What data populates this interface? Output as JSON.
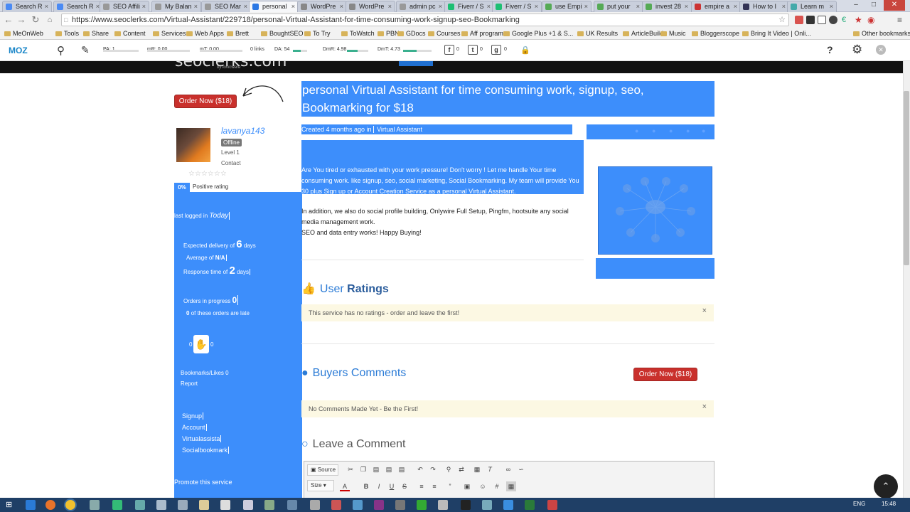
{
  "browser": {
    "tabs": [
      {
        "label": "Search R",
        "color": "#4a8af4",
        "active": false
      },
      {
        "label": "Search R",
        "color": "#4a8af4",
        "active": false
      },
      {
        "label": "SEO Affili",
        "color": "#999",
        "active": false
      },
      {
        "label": "My Balan",
        "color": "#999",
        "active": false
      },
      {
        "label": "SEO Mar",
        "color": "#999",
        "active": false
      },
      {
        "label": "personal",
        "color": "#2b78e4",
        "active": true
      },
      {
        "label": "WordPre",
        "color": "#888",
        "active": false
      },
      {
        "label": "WordPre",
        "color": "#888",
        "active": false
      },
      {
        "label": "admin pc",
        "color": "#999",
        "active": false
      },
      {
        "label": "Fiverr / S",
        "color": "#1dbf73",
        "active": false
      },
      {
        "label": "Fiverr / S",
        "color": "#1dbf73",
        "active": false
      },
      {
        "label": "use Empi",
        "color": "#5a5",
        "active": false
      },
      {
        "label": "put your",
        "color": "#5a5",
        "active": false
      },
      {
        "label": "invest 28",
        "color": "#5a5",
        "active": false
      },
      {
        "label": "empire a",
        "color": "#c33",
        "active": false
      },
      {
        "label": "How to I",
        "color": "#335",
        "active": false
      },
      {
        "label": "Learn m",
        "color": "#4aa",
        "active": false
      }
    ],
    "url": "https://www.seoclerks.com/Virtual-Assistant/229718/personal-Virtual-Assistant-for-time-consuming-work-signup-seo-Bookmarking",
    "bookmarks": [
      "MeOnWeb",
      "Tools",
      "Share",
      "Content",
      "Services",
      "Web Apps",
      "Brett",
      "BoughtSEO",
      "To Try",
      "ToWatch",
      "PBN",
      "GDocs",
      "Courses",
      "Aff programs",
      "Google Plus +1 & S...",
      "UK Results",
      "ArticleBuild",
      "Music",
      "Bloggerscope",
      "Bring It Video | Onli...",
      "Other bookmarks"
    ]
  },
  "moz": {
    "logo": "MOZ",
    "pa": "PA: 1",
    "mr": "mR: 0.00",
    "mt": "mT: 0.00",
    "links": "0 links",
    "da": "DA: 54",
    "dmr": "DmR: 4.98",
    "dmt": "DmT: 4.73",
    "fb_count": "0",
    "tw_count": "0",
    "gp_count": "0",
    "da_pct": 54,
    "dmr_pct": 50,
    "dmt_pct": 47
  },
  "site": {
    "logo_text": "seoclerks.com",
    "logo_sub": "by ionicware"
  },
  "sidebar": {
    "order_btn": "Order Now ($18)",
    "username": "lavanya143",
    "status": "Offline",
    "level": "Level 1",
    "contact": "Contact",
    "rating_pct": "0%",
    "rating_label": "Positive rating",
    "last_logged_label": "last logged in",
    "last_logged_value": "Today",
    "delivery_prefix": "Expected delivery of",
    "delivery_num": "6",
    "delivery_unit": "days",
    "average_label": "Average of",
    "average_value": "N/A",
    "response_prefix": "Response time of",
    "response_num": "2",
    "response_unit": "days",
    "orders_label": "Orders in progress",
    "orders_num": "0",
    "late_num": "0",
    "late_label": "of these orders are late",
    "left_count": "0",
    "right_count": "0",
    "bookmarks_label": "Bookmarks/Likes 0",
    "report": "Report",
    "tags": [
      "Signup",
      "Account",
      "Virtualassista",
      "Socialbookmark"
    ],
    "promote": "Promote this service"
  },
  "main": {
    "title": "personal Virtual Assistant for time consuming work, signup, seo, Bookmarking for $18",
    "created": "Created 4 months ago in",
    "category": "Virtual Assistant",
    "desc1": "Are You tired or exhausted with your work pressure! Don't worry ! Let me handle Your time consuming work. like signup, seo, social marketing, Social Bookmarking. My team will provide You 30 plus Sign up or Account Creation Service as a personal Virtual Assistant.",
    "desc2": "In addition, we also do social profile building, Onlywire Full Setup, Pingfm, hootsuite any social media management work.",
    "desc3": "SEO and data entry works! Happy Buying!",
    "ratings_prefix": "User",
    "ratings_bold": "Ratings",
    "ratings_notice": "This service has no ratings - order and leave the first!",
    "comments_heading": "Buyers Comments",
    "comments_order_btn": "Order Now ($18)",
    "comments_notice": "No Comments Made Yet - Be the First!",
    "leave_heading": "Leave a Comment",
    "editor_source": "Source",
    "editor_size": "Size"
  },
  "taskbar": {
    "lang": "ENG",
    "clock": "15:48"
  },
  "colors": {
    "selection": "#3d8efb",
    "order_red": "#c9302c",
    "link_blue": "#2b7bd6"
  }
}
